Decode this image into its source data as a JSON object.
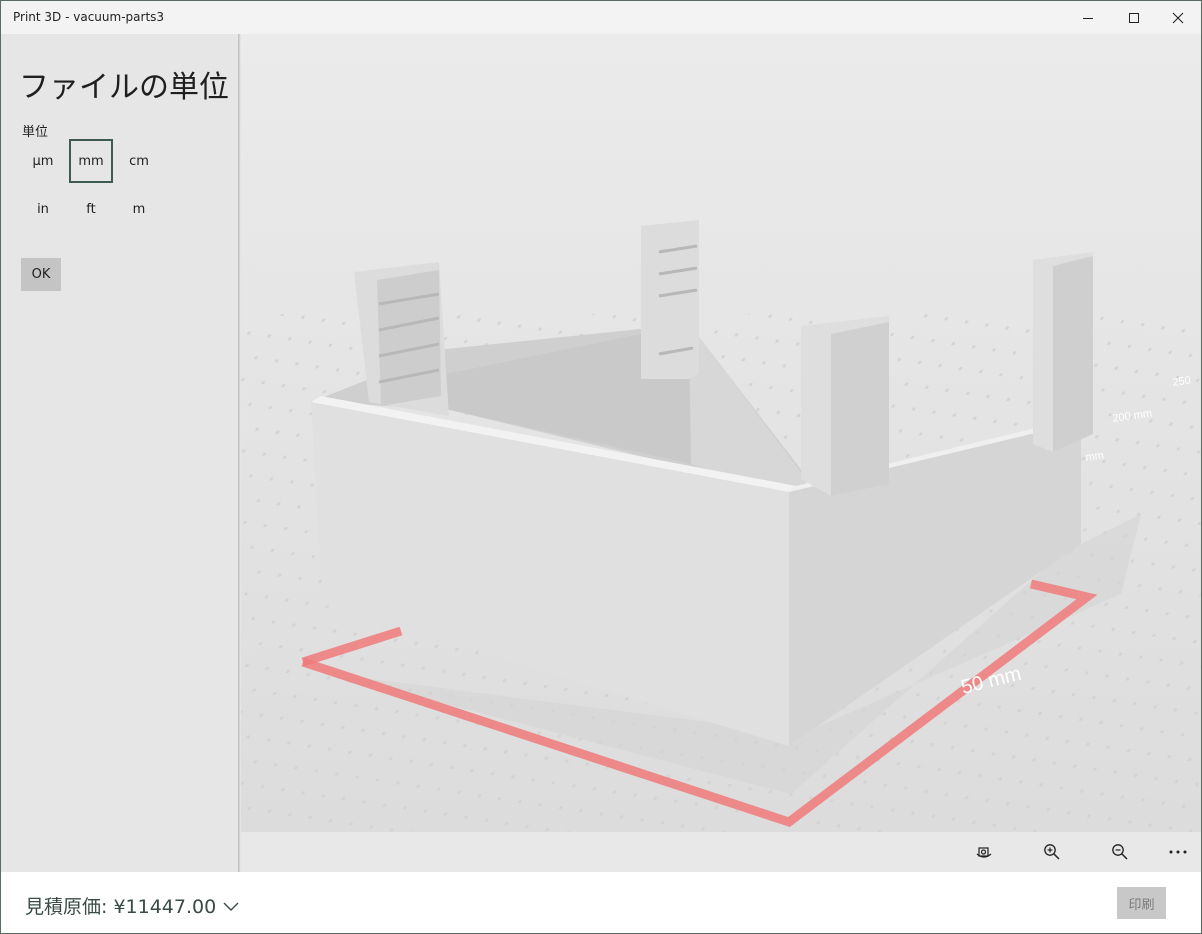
{
  "window": {
    "title": "Print 3D - vacuum-parts3"
  },
  "panel": {
    "title": "ファイルの単位",
    "unit_label": "単位",
    "units": [
      "μm",
      "mm",
      "cm",
      "in",
      "ft",
      "m"
    ],
    "selected_unit": "mm",
    "ok_label": "OK"
  },
  "viewport": {
    "dimension_labels": [
      "200 mm",
      "250",
      "mm",
      "50 mm"
    ]
  },
  "toolbar": {
    "icons": [
      "reset-view-icon",
      "zoom-in-icon",
      "zoom-out-icon",
      "more-icon"
    ]
  },
  "footer": {
    "estimate_label": "見積原価: ¥11447.00",
    "print_label": "印刷"
  },
  "colors": {
    "accent": "#3e5a52",
    "build_area_outline": "#f07a7a",
    "sidebar_bg": "#e6e6e6"
  }
}
